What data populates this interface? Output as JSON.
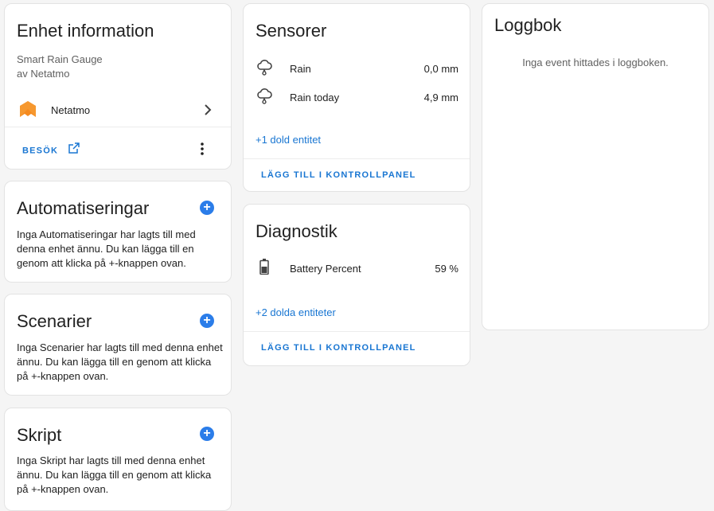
{
  "device_info": {
    "title": "Enhet information",
    "model": "Smart Rain Gauge",
    "manufacturer": "av Netatmo",
    "integration": "Netatmo",
    "visit_label": "BESÖK"
  },
  "automations": {
    "title": "Automatiseringar",
    "text": "Inga Automatiseringar har lagts till med denna enhet ännu. Du kan lägga till en genom att klicka på +-knappen ovan."
  },
  "scenes": {
    "title": "Scenarier",
    "text": "Inga Scenarier har lagts till med denna enhet ännu. Du kan lägga till en genom att klicka på +-knappen ovan."
  },
  "scripts": {
    "title": "Skript",
    "text": "Inga Skript har lagts till med denna enhet ännu. Du kan lägga till en genom att klicka på +-knappen ovan."
  },
  "sensors": {
    "title": "Sensorer",
    "items": [
      {
        "label": "Rain",
        "value": "0,0 mm",
        "icon": "cloud-rain-icon"
      },
      {
        "label": "Rain today",
        "value": "4,9 mm",
        "icon": "cloud-rain-icon"
      }
    ],
    "hidden_link": "+1 dold entitet",
    "add_label": "LÄGG TILL I KONTROLLPANEL"
  },
  "diagnostics": {
    "title": "Diagnostik",
    "items": [
      {
        "label": "Battery Percent",
        "value": "59 %",
        "icon": "battery-icon"
      }
    ],
    "hidden_link": "+2 dolda entiteter",
    "add_label": "LÄGG TILL I KONTROLLPANEL"
  },
  "logbook": {
    "title": "Loggbok",
    "empty_text": "Inga event hittades i loggboken."
  },
  "colors": {
    "accent": "#1976d2",
    "plus_button": "#2b7de9",
    "netatmo_logo": "#f58a1f"
  }
}
